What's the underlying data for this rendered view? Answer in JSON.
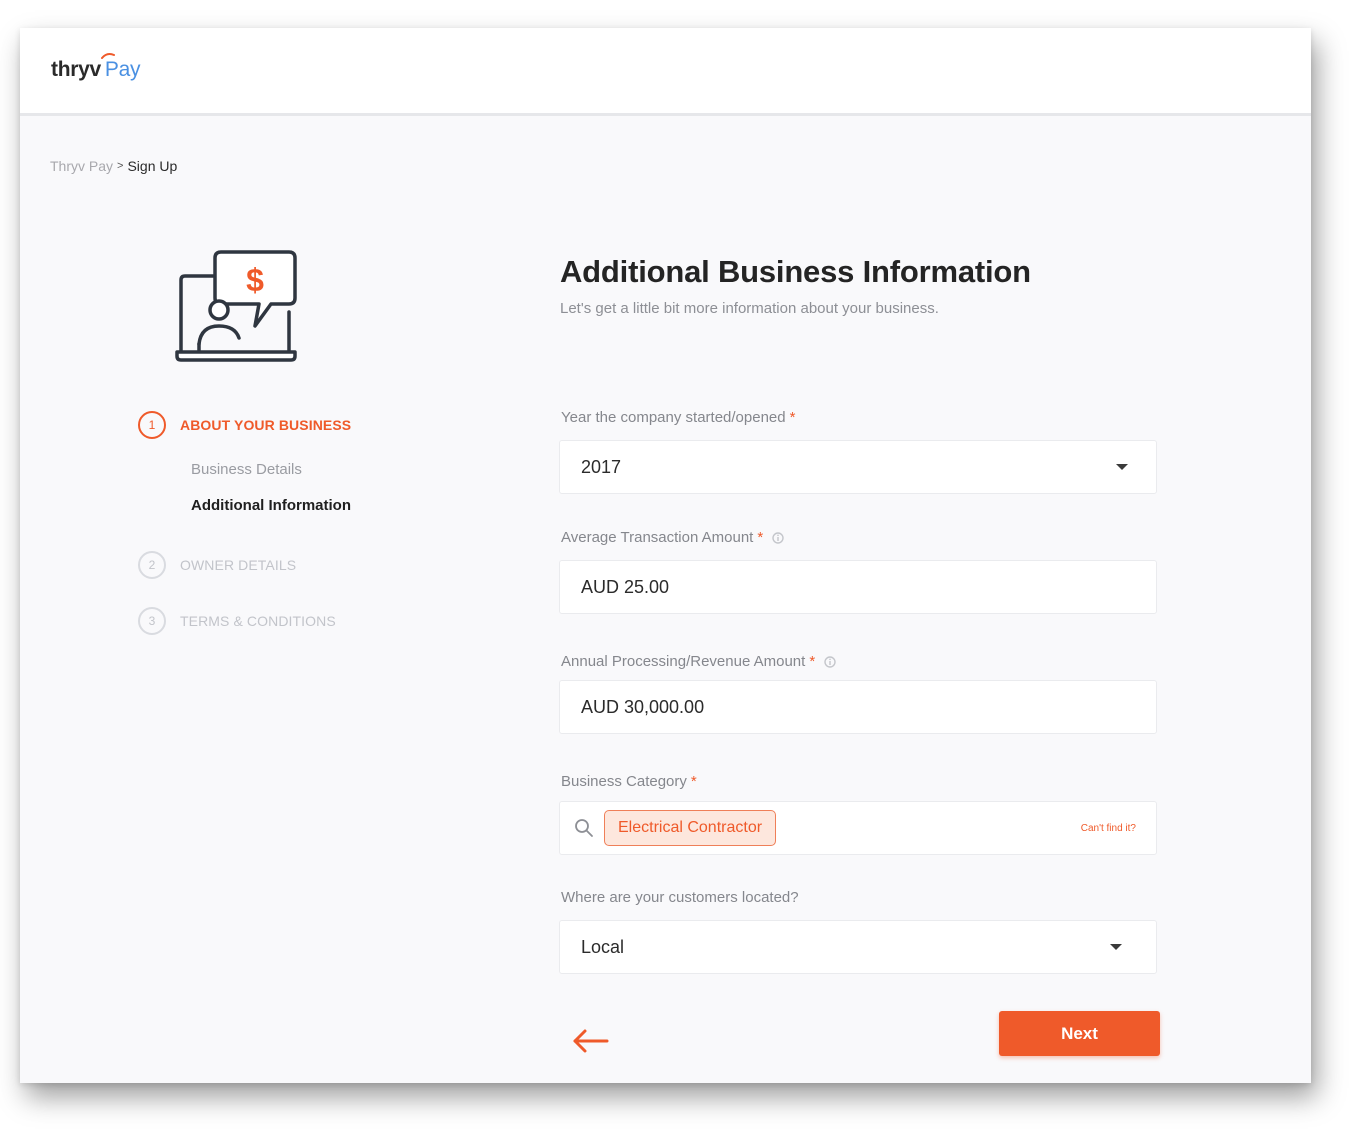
{
  "header": {
    "logo_part1": "thryv",
    "logo_part2": "Pay"
  },
  "breadcrumb": {
    "root": "Thryv Pay",
    "separator": ">",
    "current": "Sign Up"
  },
  "steps": [
    {
      "number": "1",
      "label": "ABOUT YOUR BUSINESS",
      "active": true,
      "substeps": [
        {
          "label": "Business Details",
          "state": "done"
        },
        {
          "label": "Additional Information",
          "state": "current"
        }
      ]
    },
    {
      "number": "2",
      "label": "OWNER DETAILS",
      "active": false
    },
    {
      "number": "3",
      "label": "TERMS & CONDITIONS",
      "active": false
    }
  ],
  "form": {
    "title": "Additional Business Information",
    "subtitle": "Let's get a little bit more information about your business.",
    "fields": {
      "year": {
        "label": "Year the company started/opened",
        "required": "*",
        "value": "2017"
      },
      "avg_transaction": {
        "label": "Average Transaction Amount",
        "required": "*",
        "value": "AUD 25.00"
      },
      "annual_revenue": {
        "label": "Annual Processing/Revenue Amount",
        "required": "*",
        "value": "AUD 30,000.00"
      },
      "category": {
        "label": "Business Category",
        "required": "*",
        "chip": "Electrical Contractor",
        "cant_find": "Can't find it?"
      },
      "customers": {
        "label": "Where are your customers located?",
        "value": "Local"
      }
    },
    "next_label": "Next"
  },
  "colors": {
    "accent": "#ef5a2a",
    "logo_blue": "#4a90e2",
    "chip_bg": "#fde7dd"
  }
}
